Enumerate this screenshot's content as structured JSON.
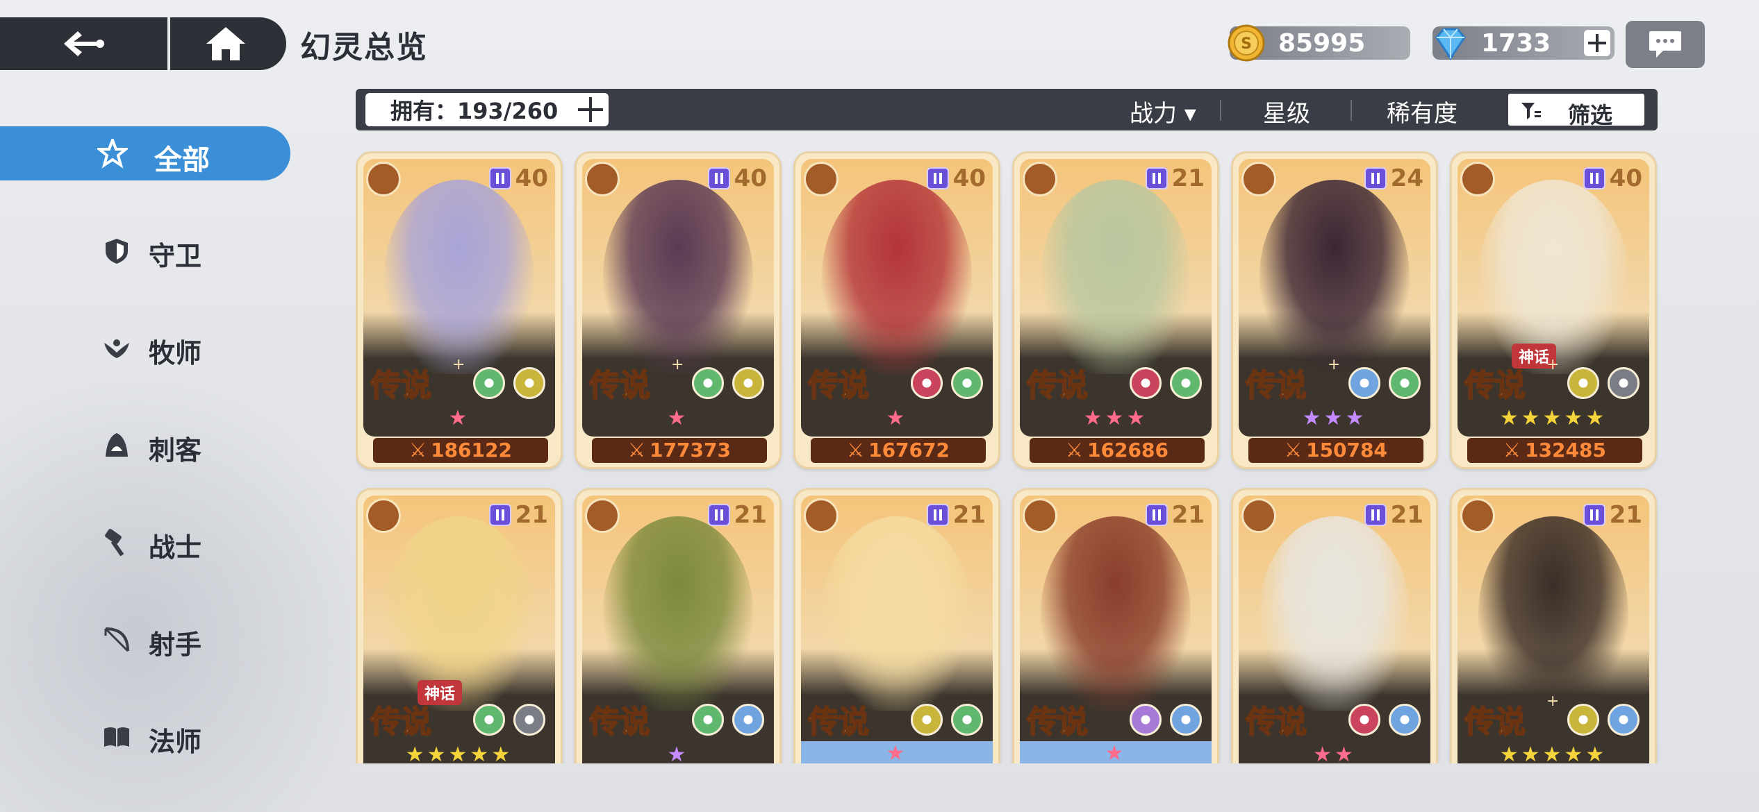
{
  "header": {
    "title": "幻灵总览",
    "gold": "85995",
    "gems": "1733"
  },
  "filterbar": {
    "owned": "拥有：193/260",
    "sort_power": "战力 ▾",
    "sort_star": "星级",
    "sort_rarity": "稀有度",
    "filter_label": "筛选"
  },
  "sidebar": {
    "items": [
      {
        "label": "全部",
        "icon": "star-icon",
        "active": true
      },
      {
        "label": "守卫",
        "icon": "shield-icon"
      },
      {
        "label": "牧师",
        "icon": "wing-icon"
      },
      {
        "label": "刺客",
        "icon": "hood-icon"
      },
      {
        "label": "战士",
        "icon": "hammer-icon"
      },
      {
        "label": "射手",
        "icon": "bow-icon"
      },
      {
        "label": "法师",
        "icon": "book-icon"
      }
    ]
  },
  "cards": [
    {
      "level": "40",
      "rarity": "传说",
      "plus": true,
      "mythic": "",
      "stars": "★",
      "star_color": "#ff6b8a",
      "power": "186122",
      "class": "book-icon",
      "elem1": "#5fb86e",
      "elem2": "#c8b53a",
      "portrait": "#a9a4d8"
    },
    {
      "level": "40",
      "rarity": "传说",
      "plus": true,
      "mythic": "",
      "stars": "★",
      "star_color": "#ff6b8a",
      "power": "177373",
      "class": "hammer-icon",
      "elem1": "#5fb86e",
      "elem2": "#c8b53a",
      "portrait": "#5b3a55"
    },
    {
      "level": "40",
      "rarity": "传说",
      "plus": false,
      "mythic": "",
      "stars": "★",
      "star_color": "#ff6b8a",
      "power": "167672",
      "class": "hammer-icon",
      "elem1": "#c9445c",
      "elem2": "#5fb86e",
      "portrait": "#b3343a"
    },
    {
      "level": "21",
      "rarity": "传说",
      "plus": false,
      "mythic": "",
      "stars": "★★★",
      "star_color": "#ff6b8a",
      "power": "162686",
      "class": "shield-icon",
      "elem1": "#c9445c",
      "elem2": "#5fb86e",
      "portrait": "#b9c7a0"
    },
    {
      "level": "24",
      "rarity": "传说",
      "plus": true,
      "mythic": "",
      "stars": "★★★",
      "star_color": "#c48aff",
      "power": "150784",
      "class": "bow-icon",
      "elem1": "#6fa4e0",
      "elem2": "#5fb86e",
      "portrait": "#3b2635"
    },
    {
      "level": "40",
      "rarity": "传说",
      "plus": true,
      "mythic": "神话",
      "stars": "★★★★★",
      "star_color": "#f5d43b",
      "power": "132485",
      "class": "book-icon",
      "elem1": "#c8b53a",
      "elem2": "#7a7d86",
      "portrait": "#efe6d4"
    },
    {
      "level": "21",
      "rarity": "传说",
      "plus": false,
      "mythic": "神话",
      "stars": "★★★★★",
      "star_color": "#f5d43b",
      "power": "",
      "class": "wing-icon",
      "elem1": "#5fb86e",
      "elem2": "#7a7d86",
      "portrait": "#f1d489"
    },
    {
      "level": "21",
      "rarity": "传说",
      "plus": false,
      "mythic": "",
      "stars": "★",
      "star_color": "#c48aff",
      "power": "",
      "class": "shield-icon",
      "elem1": "#5fb86e",
      "elem2": "#6fa4e0",
      "portrait": "#7c8a3e"
    },
    {
      "level": "21",
      "rarity": "传说",
      "plus": false,
      "mythic": "",
      "stars": "★",
      "star_color": "#ff6b8a",
      "power": "",
      "class": "wing-icon",
      "elem1": "#c8b53a",
      "elem2": "#5fb86e",
      "portrait": "#f4dca1",
      "blue": true
    },
    {
      "level": "21",
      "rarity": "传说",
      "plus": false,
      "mythic": "",
      "stars": "★",
      "star_color": "#ff6b8a",
      "power": "",
      "class": "wing-icon",
      "elem1": "#a77ad8",
      "elem2": "#6fa4e0",
      "portrait": "#8a3d2c",
      "blue": true
    },
    {
      "level": "21",
      "rarity": "传说",
      "plus": false,
      "mythic": "",
      "stars": "★★",
      "star_color": "#ff6b8a",
      "power": "",
      "class": "hood-icon",
      "elem1": "#c9445c",
      "elem2": "#6fa4e0",
      "portrait": "#e8e6e0"
    },
    {
      "level": "21",
      "rarity": "传说",
      "plus": true,
      "mythic": "",
      "stars": "★★★★★",
      "star_color": "#f5d43b",
      "power": "",
      "class": "shield-icon",
      "elem1": "#c8b53a",
      "elem2": "#6fa4e0",
      "portrait": "#3a2e28"
    }
  ]
}
